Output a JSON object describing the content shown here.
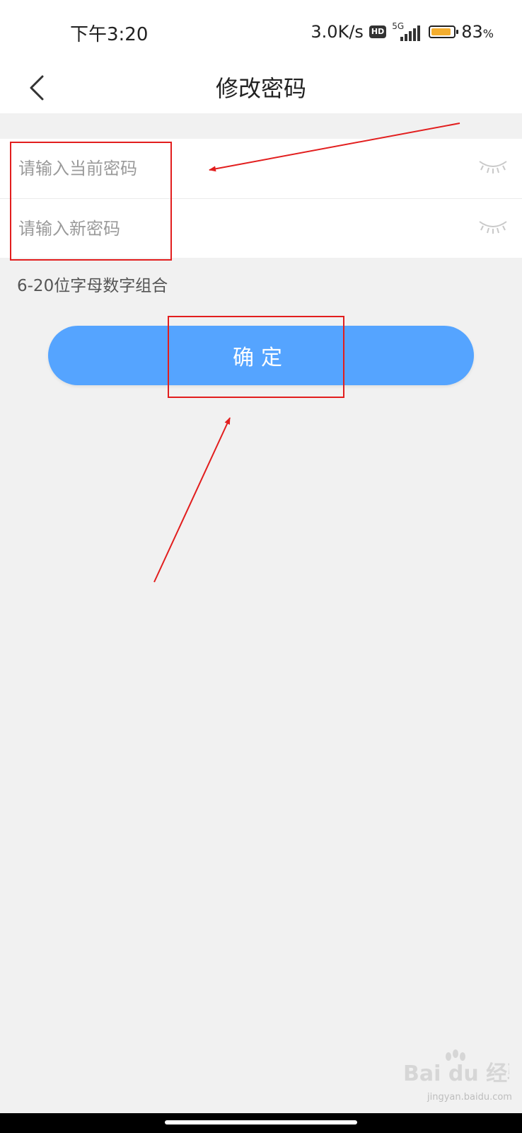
{
  "status_bar": {
    "time": "下午3:20",
    "net_speed": "3.0K/s",
    "hd_badge": "HD",
    "network": "5G",
    "battery_percent": "83",
    "battery_unit": "%",
    "battery_level": 0.83,
    "battery_color": "#f3ad2e"
  },
  "nav": {
    "title": "修改密码",
    "back_icon": "chevron-left-icon"
  },
  "form": {
    "current_password": {
      "placeholder": "请输入当前密码",
      "value": "",
      "icon": "eye-closed-icon"
    },
    "new_password": {
      "placeholder": "请输入新密码",
      "value": "",
      "icon": "eye-closed-icon"
    }
  },
  "hint": "6-20位字母数字组合",
  "confirm_button": {
    "label": "确定",
    "color": "#55a4ff"
  },
  "annotation_color": "#e21e1e",
  "watermark": {
    "logo": "Bai du 经验",
    "url": "jingyan.baidu.com"
  }
}
